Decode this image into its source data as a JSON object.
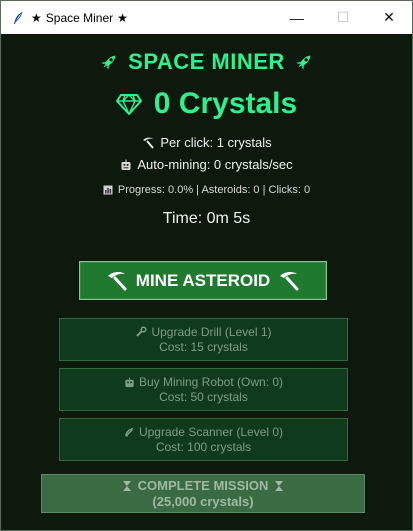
{
  "window": {
    "title": "Space Miner",
    "minimize": "—",
    "maximize": "☐",
    "close": "✕"
  },
  "game": {
    "title": "SPACE MINER",
    "crystals_text": "0 Crystals",
    "per_click": "Per click: 1 crystals",
    "auto_mining": "Auto-mining: 0 crystals/sec",
    "progress": "Progress: 0.0% | Asteroids: 0 | Clicks: 0",
    "time": "Time: 0m 5s"
  },
  "buttons": {
    "mine": "MINE ASTEROID",
    "upgrade_drill": {
      "line1": "Upgrade Drill (Level 1)",
      "line2": "Cost: 15 crystals"
    },
    "buy_robot": {
      "line1": "Buy Mining Robot (Own: 0)",
      "line2": "Cost: 50 crystals"
    },
    "upgrade_scanner": {
      "line1": "Upgrade Scanner (Level 0)",
      "line2": "Cost: 100 crystals"
    },
    "complete_mission": {
      "line1": "COMPLETE MISSION",
      "line2": "(25,000 crystals)"
    }
  },
  "colors": {
    "accent": "#2ff08f",
    "background": "#0c190c",
    "mine_button": "#1f7a30",
    "upgrade_button": "#0f3a1b",
    "complete_button": "#3a6b42"
  }
}
